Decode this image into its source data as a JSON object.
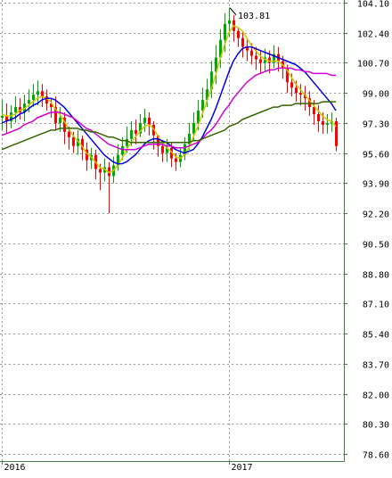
{
  "chart_data": {
    "type": "candlestick",
    "title": "",
    "xlabel": "",
    "ylabel": "",
    "grid": true,
    "ylim": [
      78.6,
      104.1
    ],
    "y_ticks": [
      "78.60",
      "80.30",
      "82.00",
      "83.70",
      "85.40",
      "87.10",
      "88.80",
      "90.50",
      "92.20",
      "93.90",
      "95.60",
      "97.30",
      "99.00",
      "100.70",
      "102.40",
      "104.10"
    ],
    "x_ticks": [
      {
        "label": "2016",
        "index": 0
      },
      {
        "label": "2017",
        "index": 51
      }
    ],
    "annotation": {
      "text": "103.81",
      "index": 51,
      "value": 103.81
    },
    "candle_count": 76,
    "candles_open": [
      97.6,
      97.7,
      97.4,
      97.9,
      98.2,
      97.9,
      98.4,
      98.6,
      98.9,
      99.1,
      98.8,
      98.4,
      98.2,
      97.3,
      97.6,
      96.8,
      96.5,
      96.0,
      96.4,
      95.8,
      95.2,
      95.5,
      94.7,
      94.5,
      94.8,
      94.3,
      94.9,
      95.5,
      96.0,
      96.4,
      96.9,
      96.7,
      97.3,
      97.6,
      97.2,
      96.6,
      96.0,
      95.6,
      95.9,
      95.3,
      95.1,
      95.5,
      96.1,
      96.7,
      97.3,
      98.0,
      98.6,
      99.2,
      100.2,
      101.0,
      102.0,
      102.9,
      103.1,
      102.5,
      102.1,
      101.6,
      101.4,
      101.1,
      100.9,
      100.7,
      101.0,
      100.7,
      101.2,
      100.8,
      100.4,
      99.6,
      99.3,
      99.0,
      98.9,
      98.7,
      98.2,
      97.8,
      97.4,
      97.2,
      97.3,
      97.4
    ],
    "candles_close": [
      97.7,
      97.4,
      97.9,
      98.2,
      97.9,
      98.4,
      98.6,
      98.9,
      99.1,
      98.8,
      98.4,
      98.2,
      97.3,
      97.6,
      96.8,
      96.5,
      96.0,
      96.4,
      95.8,
      95.2,
      95.5,
      94.7,
      94.5,
      94.8,
      94.3,
      94.9,
      95.5,
      96.0,
      96.4,
      96.9,
      96.7,
      97.3,
      97.6,
      97.2,
      96.6,
      96.0,
      95.6,
      95.9,
      95.3,
      95.1,
      95.5,
      96.1,
      96.7,
      97.3,
      98.0,
      98.6,
      99.2,
      100.2,
      101.0,
      102.0,
      102.9,
      103.1,
      102.5,
      102.1,
      101.6,
      101.4,
      101.1,
      100.9,
      100.7,
      101.0,
      100.7,
      101.2,
      100.8,
      100.4,
      99.6,
      99.3,
      99.0,
      98.9,
      98.7,
      98.2,
      97.8,
      97.4,
      97.2,
      97.3,
      97.4,
      96.0
    ],
    "candles_high": [
      98.6,
      98.4,
      98.3,
      98.8,
      98.7,
      98.9,
      99.2,
      99.5,
      99.7,
      99.5,
      99.2,
      98.7,
      98.8,
      98.2,
      97.9,
      97.1,
      96.8,
      96.9,
      96.6,
      96.2,
      95.9,
      95.8,
      95.0,
      95.3,
      95.1,
      95.4,
      96.1,
      96.5,
      97.1,
      97.4,
      97.5,
      97.8,
      98.1,
      97.9,
      97.4,
      96.5,
      96.3,
      96.4,
      96.2,
      95.6,
      95.9,
      96.5,
      97.3,
      97.9,
      98.6,
      99.3,
      99.8,
      100.8,
      101.7,
      102.6,
      103.5,
      103.81,
      103.4,
      102.7,
      102.5,
      102.0,
      101.8,
      101.6,
      101.4,
      101.5,
      101.4,
      101.7,
      101.6,
      101.1,
      100.6,
      100.1,
      99.7,
      99.5,
      99.4,
      99.1,
      98.6,
      98.3,
      97.9,
      97.8,
      97.9,
      97.6
    ],
    "candles_low": [
      96.9,
      96.7,
      97.0,
      97.3,
      97.5,
      97.4,
      97.9,
      98.2,
      98.3,
      98.2,
      98.0,
      97.6,
      96.9,
      96.8,
      96.1,
      95.8,
      95.6,
      95.5,
      95.2,
      94.6,
      94.7,
      94.1,
      93.5,
      94.0,
      92.2,
      93.9,
      94.6,
      95.2,
      95.6,
      96.0,
      96.1,
      96.5,
      96.8,
      96.6,
      95.8,
      95.4,
      95.1,
      95.1,
      94.8,
      94.6,
      94.8,
      95.2,
      95.8,
      96.3,
      96.9,
      97.6,
      98.2,
      98.7,
      99.5,
      100.4,
      101.3,
      102.2,
      101.9,
      101.6,
      101.0,
      100.8,
      100.6,
      100.3,
      100.1,
      100.2,
      100.1,
      100.4,
      100.2,
      99.8,
      99.0,
      98.8,
      98.5,
      98.3,
      98.0,
      97.7,
      97.2,
      96.8,
      96.7,
      96.7,
      96.8,
      95.7
    ],
    "series": [
      {
        "color": "#c8c800",
        "values": [
          97.8,
          97.7,
          97.7,
          97.8,
          98.0,
          98.1,
          98.3,
          98.5,
          98.7,
          98.8,
          98.7,
          98.5,
          98.1,
          97.8,
          97.4,
          97.0,
          96.6,
          96.3,
          96.0,
          95.6,
          95.4,
          95.1,
          94.8,
          94.7,
          94.5,
          94.6,
          94.9,
          95.3,
          95.8,
          96.2,
          96.5,
          96.8,
          97.1,
          97.2,
          97.0,
          96.6,
          96.2,
          95.9,
          95.7,
          95.4,
          95.3,
          95.5,
          95.9,
          96.5,
          97.1,
          97.8,
          98.5,
          99.2,
          100.0,
          100.9,
          101.7,
          102.4,
          102.8,
          102.7,
          102.5,
          102.1,
          101.7,
          101.4,
          101.1,
          100.9,
          100.8,
          100.8,
          100.8,
          100.6,
          100.3,
          99.9,
          99.5,
          99.2,
          98.9,
          98.6,
          98.3,
          98.0,
          97.7,
          97.5,
          97.4,
          97.1
        ]
      },
      {
        "color": "#0000dd",
        "values": [
          97.3,
          97.4,
          97.5,
          97.6,
          97.8,
          97.9,
          98.1,
          98.3,
          98.4,
          98.6,
          98.7,
          98.7,
          98.6,
          98.4,
          98.2,
          97.9,
          97.6,
          97.3,
          97.0,
          96.7,
          96.4,
          96.1,
          95.8,
          95.5,
          95.3,
          95.1,
          95.0,
          95.0,
          95.1,
          95.3,
          95.5,
          95.8,
          96.1,
          96.3,
          96.4,
          96.4,
          96.3,
          96.2,
          96.0,
          95.8,
          95.7,
          95.6,
          95.7,
          95.8,
          96.1,
          96.5,
          97.0,
          97.5,
          98.1,
          98.8,
          99.5,
          100.2,
          100.8,
          101.2,
          101.5,
          101.6,
          101.6,
          101.5,
          101.4,
          101.3,
          101.2,
          101.1,
          101.0,
          100.9,
          100.8,
          100.7,
          100.6,
          100.4,
          100.2,
          99.9,
          99.6,
          99.3,
          99.0,
          98.7,
          98.4,
          98.0
        ]
      },
      {
        "color": "#d000d0",
        "values": [
          96.6,
          96.7,
          96.8,
          96.9,
          97.0,
          97.2,
          97.3,
          97.4,
          97.6,
          97.7,
          97.8,
          97.9,
          97.9,
          97.9,
          97.8,
          97.7,
          97.6,
          97.4,
          97.2,
          97.0,
          96.9,
          96.7,
          96.5,
          96.3,
          96.1,
          96.0,
          95.9,
          95.8,
          95.8,
          95.8,
          95.8,
          95.9,
          96.0,
          96.1,
          96.1,
          96.1,
          96.1,
          96.0,
          96.0,
          95.9,
          95.9,
          95.9,
          96.0,
          96.1,
          96.2,
          96.4,
          96.7,
          96.9,
          97.2,
          97.6,
          98.0,
          98.3,
          98.7,
          99.0,
          99.3,
          99.6,
          99.8,
          100.0,
          100.1,
          100.2,
          100.3,
          100.3,
          100.4,
          100.4,
          100.4,
          100.4,
          100.3,
          100.3,
          100.2,
          100.2,
          100.1,
          100.1,
          100.1,
          100.1,
          100.0,
          100.0
        ]
      },
      {
        "color": "#336600",
        "values": [
          95.8,
          95.9,
          96.0,
          96.1,
          96.2,
          96.3,
          96.4,
          96.5,
          96.6,
          96.7,
          96.8,
          96.9,
          96.9,
          97.0,
          97.0,
          97.0,
          97.0,
          97.0,
          96.9,
          96.9,
          96.8,
          96.8,
          96.7,
          96.6,
          96.5,
          96.5,
          96.4,
          96.3,
          96.3,
          96.2,
          96.2,
          96.2,
          96.2,
          96.2,
          96.2,
          96.2,
          96.2,
          96.2,
          96.2,
          96.2,
          96.2,
          96.2,
          96.2,
          96.3,
          96.3,
          96.4,
          96.5,
          96.6,
          96.7,
          96.8,
          96.9,
          97.1,
          97.2,
          97.3,
          97.5,
          97.6,
          97.7,
          97.8,
          97.9,
          98.0,
          98.1,
          98.2,
          98.2,
          98.3,
          98.3,
          98.3,
          98.4,
          98.4,
          98.4,
          98.4,
          98.4,
          98.4,
          98.5,
          98.5,
          98.5,
          98.5
        ]
      }
    ],
    "colors": {
      "up": "#00aa00",
      "down": "#ff0000",
      "grid": "#999999",
      "axis": "#4a7a4a"
    }
  }
}
